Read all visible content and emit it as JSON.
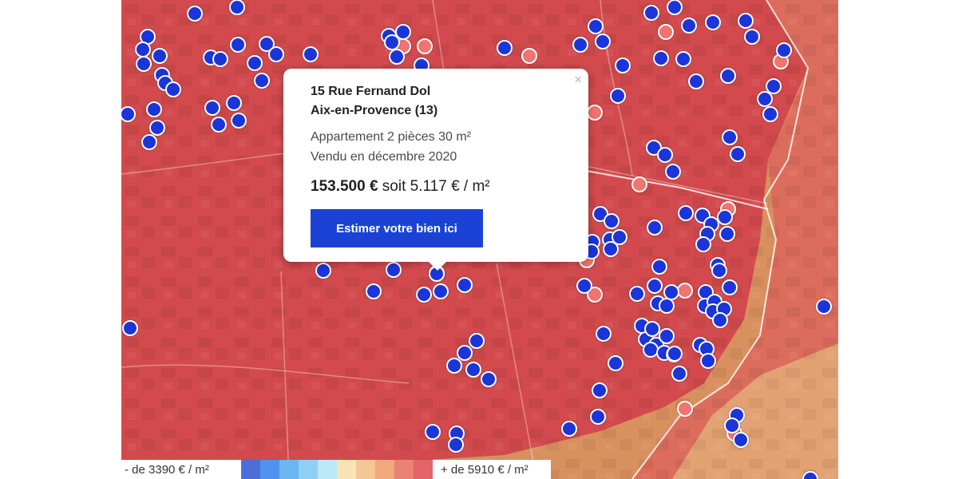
{
  "popup": {
    "address": "15 Rue Fernand Dol",
    "city": "Aix-en-Provence (13)",
    "description": "Appartement 2 pièces 30 m²",
    "sold": "Vendu en décembre 2020",
    "price": "153.500 €",
    "price_per_m2": " soit 5.117 € / m²",
    "button_label": "Estimer votre bien ici",
    "close_glyph": "×"
  },
  "legend": {
    "low_label": "- de 3390 € / m²",
    "high_label": "+ de 5910 € / m²",
    "scale_colors": [
      "#4b6fd9",
      "#4f93ef",
      "#6bb7f2",
      "#8fd1f5",
      "#b9e8f7",
      "#f7e4b5",
      "#f6c796",
      "#f2a77d",
      "#e98273",
      "#e36469"
    ]
  },
  "map": {
    "zone_colors": {
      "high": "#d24a4d",
      "mid": "#dc6d5d",
      "low": "#e3a274"
    },
    "marker_colors": {
      "sold": "#1b35d9",
      "other": "#f07470"
    }
  }
}
